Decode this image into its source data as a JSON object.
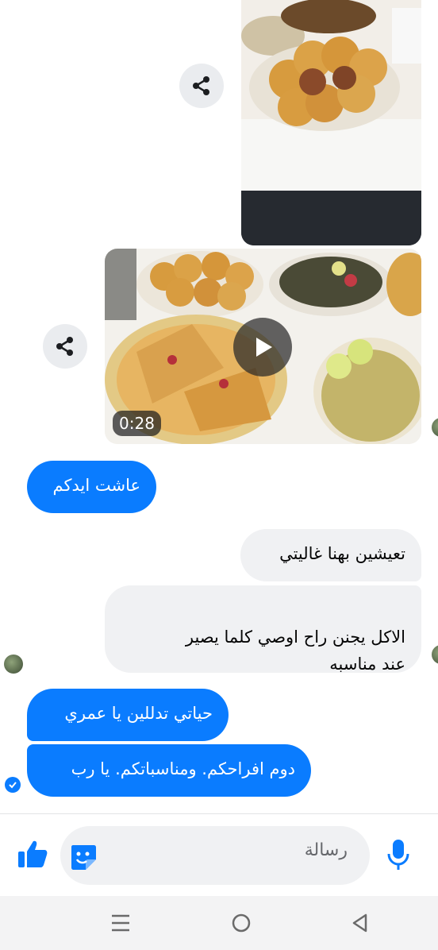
{
  "media": {
    "top_photo_icon": "food-photo",
    "video_duration": "0:28",
    "share_icon": "share-icon",
    "play_icon": "play-icon"
  },
  "messages": [
    {
      "side": "outgoing",
      "text": "عاشت ايدكم"
    },
    {
      "side": "incoming",
      "text": "تعيشين بهنا غاليتي"
    },
    {
      "side": "incoming",
      "text": "الاكل يجنن راح اوصي كلما يصير\nعند مناسبه"
    },
    {
      "side": "outgoing",
      "text": "حياتي تدللين يا عمري"
    },
    {
      "side": "outgoing",
      "text": "دوم افراحكم. ومناسباتكم. يا رب"
    }
  ],
  "composer": {
    "placeholder": "رسالة",
    "like_icon": "thumbs-up-icon",
    "sticker_icon": "sticker-icon",
    "mic_icon": "microphone-icon"
  },
  "colors": {
    "accent": "#0a7cff",
    "incoming_bubble": "#f0f1f3",
    "background": "#ffffff"
  }
}
